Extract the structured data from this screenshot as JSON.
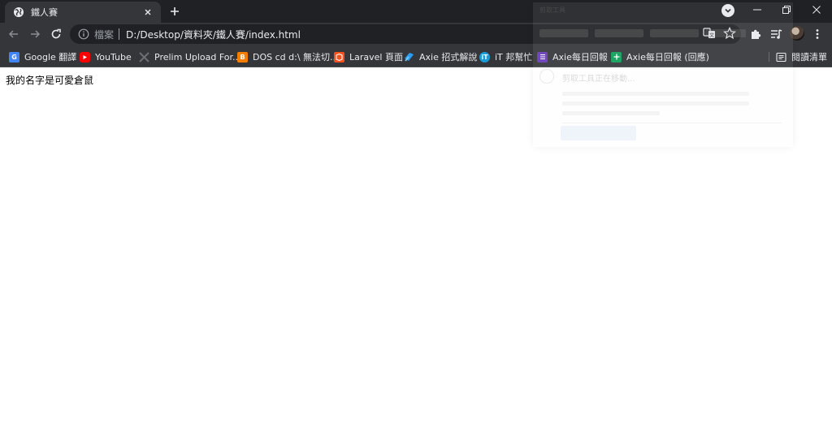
{
  "tab": {
    "title": "鐵人賽",
    "favicon": "globe-icon"
  },
  "omnibox": {
    "chip": "檔案",
    "url": "D:/Desktop/資料夾/鐵人賽/index.html"
  },
  "bookmarks": [
    {
      "label": "Google 翻譯",
      "icon": "google-translate-icon",
      "color": "#4285f4"
    },
    {
      "label": "YouTube",
      "icon": "youtube-icon",
      "color": "#ff0000"
    },
    {
      "label": "Prelim Upload For...",
      "icon": "x-mark-icon",
      "color": "#5f6368"
    },
    {
      "label": "DOS cd d:\\ 無法切...",
      "icon": "blogger-icon",
      "color": "#f57d00"
    },
    {
      "label": "Laravel 頁面",
      "icon": "laravel-icon",
      "color": "#f4511e"
    },
    {
      "label": "Axie 招式解說",
      "icon": "axie-icon",
      "color": "#2a9df4"
    },
    {
      "label": "iT 邦幫忙",
      "icon": "ithelp-icon",
      "color": "#1a9cd8"
    },
    {
      "label": "Axie每日回報",
      "icon": "google-forms-icon",
      "color": "#673ab7"
    },
    {
      "label": "Axie每日回報 (回應)",
      "icon": "google-sheets-icon",
      "color": "#0f9d58"
    }
  ],
  "reading_list": {
    "label": "閱讀清單"
  },
  "page": {
    "text": "我的名字是可愛倉鼠"
  },
  "snip_overlay": {
    "header": "剪取工具",
    "title": "剪取工具正在移動..."
  }
}
